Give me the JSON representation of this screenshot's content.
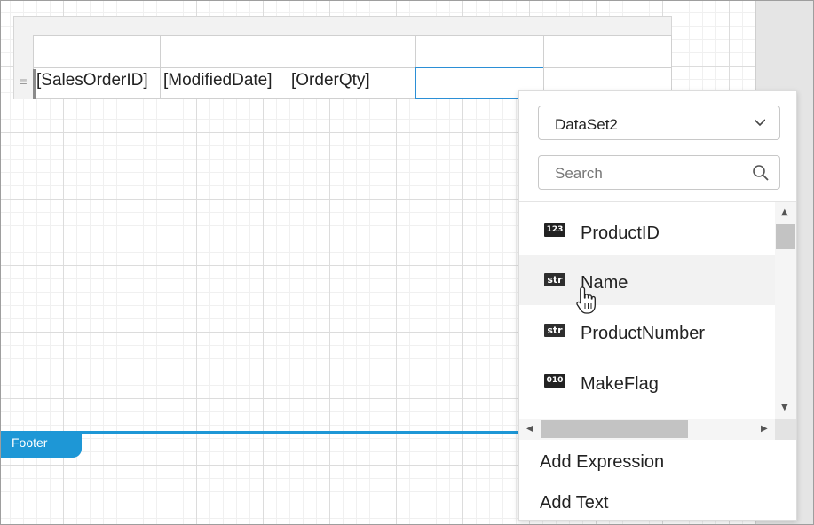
{
  "table": {
    "cells": [
      "[SalesOrderID]",
      "[ModifiedDate]",
      "[OrderQty]"
    ]
  },
  "footer": {
    "label": "Footer"
  },
  "field_picker": {
    "dataset": {
      "selected": "DataSet2"
    },
    "search": {
      "placeholder": "Search"
    },
    "fields": [
      {
        "type_badge": "123",
        "name": "ProductID"
      },
      {
        "type_badge": "str",
        "name": "Name"
      },
      {
        "type_badge": "str",
        "name": "ProductNumber"
      },
      {
        "type_badge": "010",
        "name": "MakeFlag"
      }
    ],
    "actions": {
      "add_expression": "Add Expression",
      "add_text": "Add Text"
    }
  },
  "colors": {
    "accent": "#1e97d6",
    "selection_border": "#2b8fd6"
  },
  "icons": {
    "dataset_dropdown": "chevron-down-icon",
    "search": "search-icon",
    "cursor": "hand-pointer-icon"
  }
}
